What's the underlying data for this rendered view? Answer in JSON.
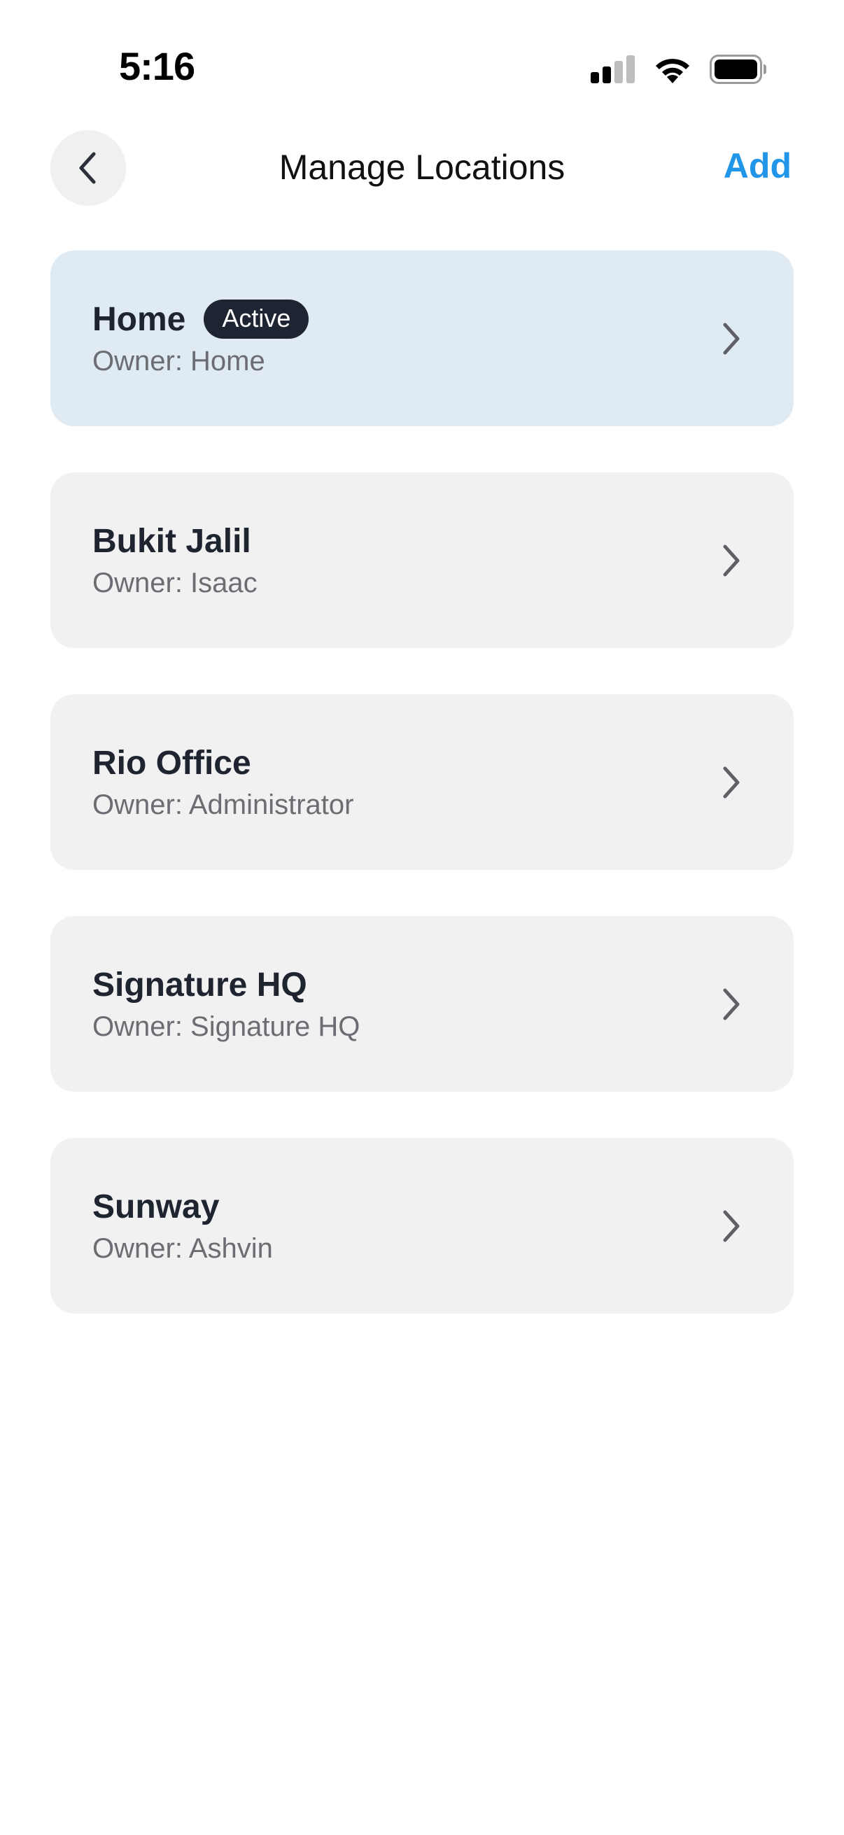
{
  "status_bar": {
    "time": "5:16",
    "icons": [
      "cellular-signal-icon",
      "wifi-icon",
      "battery-icon"
    ]
  },
  "header": {
    "back_icon": "chevron-left-icon",
    "title": "Manage Locations",
    "add_label": "Add"
  },
  "colors": {
    "accent": "#2196e8",
    "card_bg": "#f1f1f2",
    "active_card_bg": "#dfeaf2",
    "badge_bg": "#1e2532"
  },
  "locations": [
    {
      "name": "Home",
      "owner": "Owner: Home",
      "badge": "Active",
      "active": true
    },
    {
      "name": "Bukit Jalil",
      "owner": "Owner: Isaac"
    },
    {
      "name": "Rio Office",
      "owner": "Owner: Administrator"
    },
    {
      "name": "Signature HQ",
      "owner": "Owner: Signature HQ"
    },
    {
      "name": "Sunway",
      "owner": "Owner: Ashvin"
    }
  ]
}
